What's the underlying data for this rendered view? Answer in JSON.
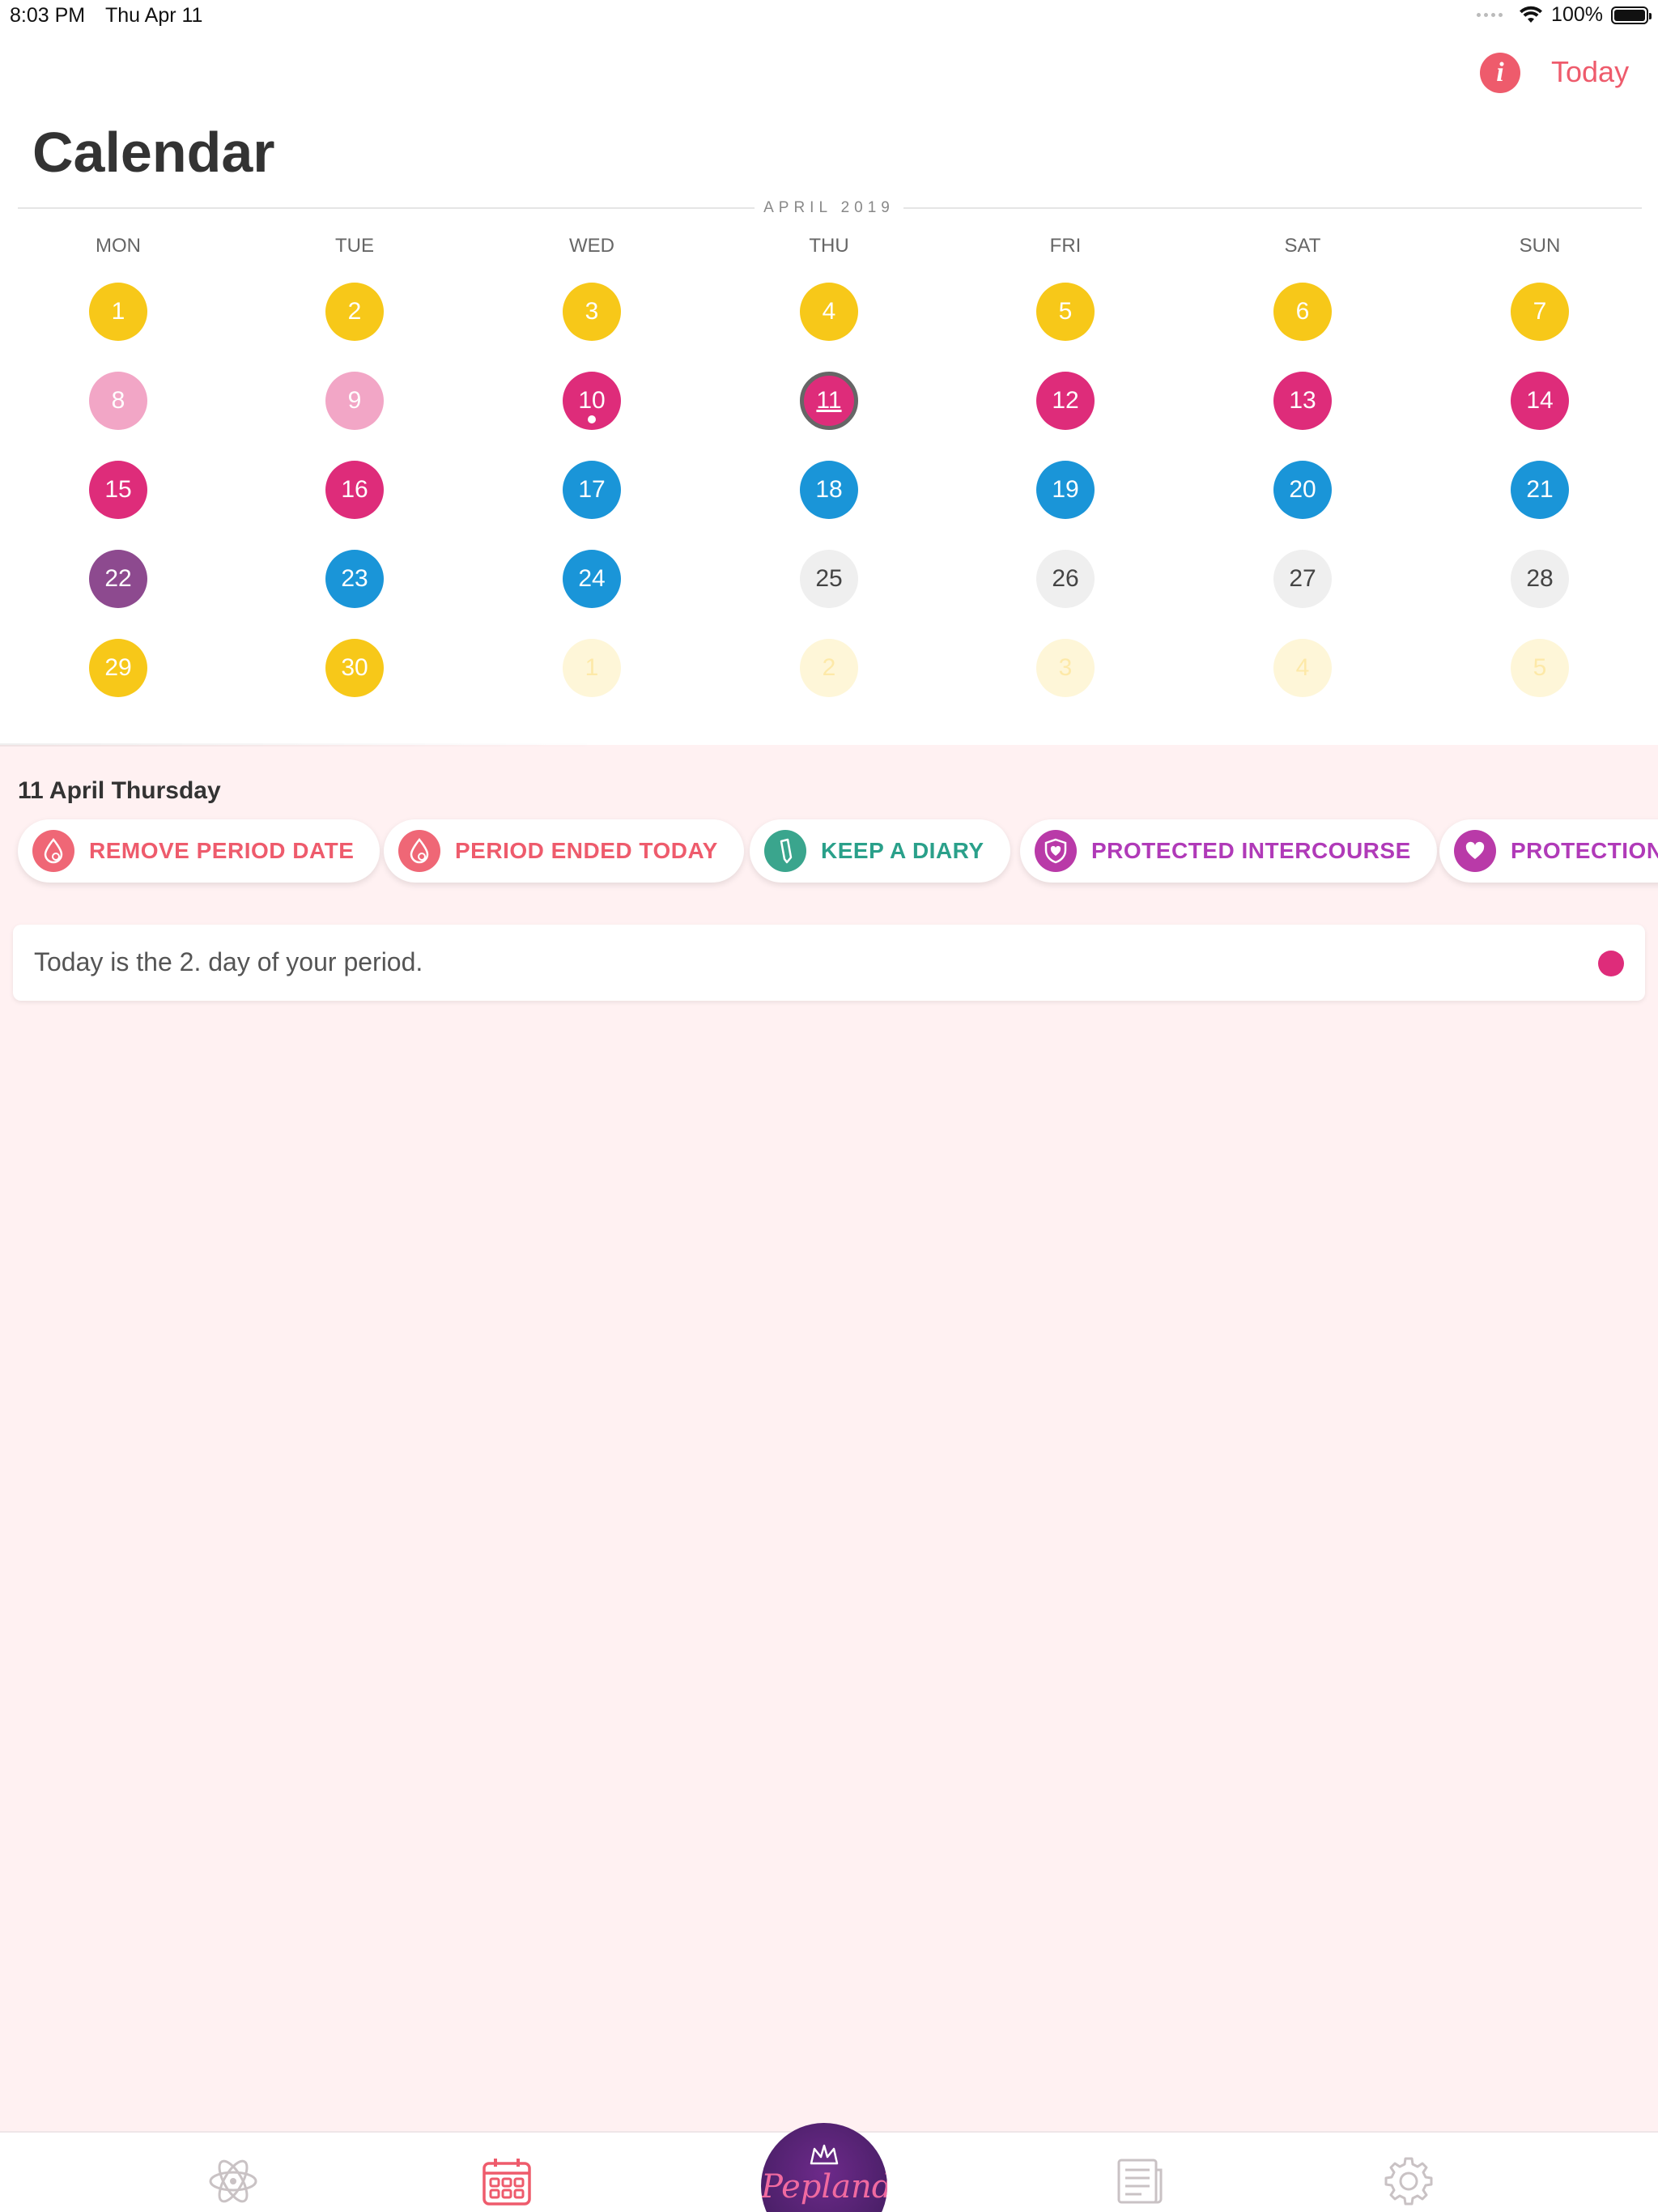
{
  "status_bar": {
    "time": "8:03 PM",
    "date": "Thu Apr 11",
    "battery": "100%"
  },
  "nav": {
    "info_label": "i",
    "today_label": "Today"
  },
  "page": {
    "title": "Calendar"
  },
  "calendar": {
    "month_label": "APRIL 2019",
    "weekdays": [
      "MON",
      "TUE",
      "WED",
      "THU",
      "FRI",
      "SAT",
      "SUN"
    ],
    "colors": {
      "yellow": "#f7c819",
      "lightpink": "#f2a6c6",
      "magenta": "#de2c7a",
      "blue": "#1a95d8",
      "purple": "#8d4a8f",
      "grey": "#efefef",
      "faded": "#fef6d8"
    },
    "weeks": [
      [
        {
          "n": "1",
          "c": "yellow"
        },
        {
          "n": "2",
          "c": "yellow"
        },
        {
          "n": "3",
          "c": "yellow"
        },
        {
          "n": "4",
          "c": "yellow"
        },
        {
          "n": "5",
          "c": "yellow"
        },
        {
          "n": "6",
          "c": "yellow"
        },
        {
          "n": "7",
          "c": "yellow"
        }
      ],
      [
        {
          "n": "8",
          "c": "lightpink"
        },
        {
          "n": "9",
          "c": "lightpink"
        },
        {
          "n": "10",
          "c": "magenta",
          "dot": true
        },
        {
          "n": "11",
          "c": "magenta",
          "selected": true
        },
        {
          "n": "12",
          "c": "magenta"
        },
        {
          "n": "13",
          "c": "magenta"
        },
        {
          "n": "14",
          "c": "magenta"
        }
      ],
      [
        {
          "n": "15",
          "c": "magenta"
        },
        {
          "n": "16",
          "c": "magenta"
        },
        {
          "n": "17",
          "c": "blue"
        },
        {
          "n": "18",
          "c": "blue"
        },
        {
          "n": "19",
          "c": "blue"
        },
        {
          "n": "20",
          "c": "blue"
        },
        {
          "n": "21",
          "c": "blue"
        }
      ],
      [
        {
          "n": "22",
          "c": "purple"
        },
        {
          "n": "23",
          "c": "blue"
        },
        {
          "n": "24",
          "c": "blue"
        },
        {
          "n": "25",
          "c": "grey"
        },
        {
          "n": "26",
          "c": "grey"
        },
        {
          "n": "27",
          "c": "grey"
        },
        {
          "n": "28",
          "c": "grey"
        }
      ],
      [
        {
          "n": "29",
          "c": "yellow"
        },
        {
          "n": "30",
          "c": "yellow"
        },
        {
          "n": "1",
          "c": "faded"
        },
        {
          "n": "2",
          "c": "faded"
        },
        {
          "n": "3",
          "c": "faded"
        },
        {
          "n": "4",
          "c": "faded"
        },
        {
          "n": "5",
          "c": "faded"
        }
      ]
    ]
  },
  "selected_day": {
    "label": "11 April Thursday",
    "actions": [
      {
        "label": "REMOVE PERIOD DATE",
        "icon": "drop-icon",
        "color": "#ee5b6c"
      },
      {
        "label": "PERIOD ENDED TODAY",
        "icon": "drop-icon",
        "color": "#ee5b6c"
      },
      {
        "label": "KEEP A DIARY",
        "icon": "pencil-icon",
        "color": "#2aa08a"
      },
      {
        "label": "PROTECTED INTERCOURSE",
        "icon": "shield-heart-icon",
        "color": "#b03ab8"
      },
      {
        "label": "PROTECTION",
        "icon": "heart-icon",
        "color": "#b03ab8"
      }
    ],
    "info_text": "Today is the 2. day of your period.",
    "info_dot_color": "#de2c7a"
  },
  "tab_bar": {
    "items": [
      "atom-icon",
      "calendar-icon",
      "logo",
      "newspaper-icon",
      "gear-icon"
    ],
    "logo_text": "Pepland",
    "active_color": "#ee5b6c",
    "inactive_color": "#c9c2c4"
  }
}
